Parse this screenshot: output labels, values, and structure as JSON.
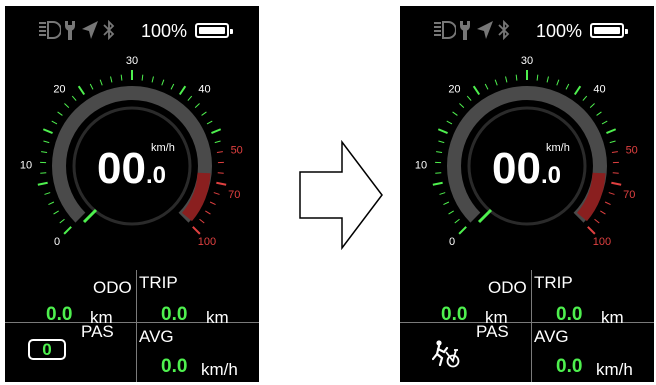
{
  "status": {
    "battery_text": "100%",
    "icons": [
      "headlight-icon",
      "wrench-icon",
      "navigation-icon",
      "bluetooth-icon",
      "battery-icon"
    ]
  },
  "gauge": {
    "tick_labels": [
      "0",
      "10",
      "20",
      "30",
      "40",
      "50",
      "70",
      "100"
    ],
    "speed_main": "00",
    "speed_decimal": ".0",
    "speed_unit": "km/h",
    "speed_value": 0,
    "colors": {
      "normal_ticks": "#4ef04e",
      "warning_ticks": "#e04040",
      "arc": "#4a4a4a"
    }
  },
  "stats": {
    "odo_label": "ODO",
    "odo_value": "0.0",
    "odo_unit": "km",
    "trip_label": "TRIP",
    "trip_value": "0.0",
    "trip_unit": "km",
    "pas_label": "PAS",
    "avg_label": "AVG",
    "avg_value": "0.0",
    "avg_unit": "km/h"
  },
  "screens": {
    "left": {
      "pas_value": "0"
    },
    "right": {
      "pas_mode_icon": "walk-assist-icon"
    }
  },
  "transition": {
    "icon": "right-arrow-icon"
  }
}
